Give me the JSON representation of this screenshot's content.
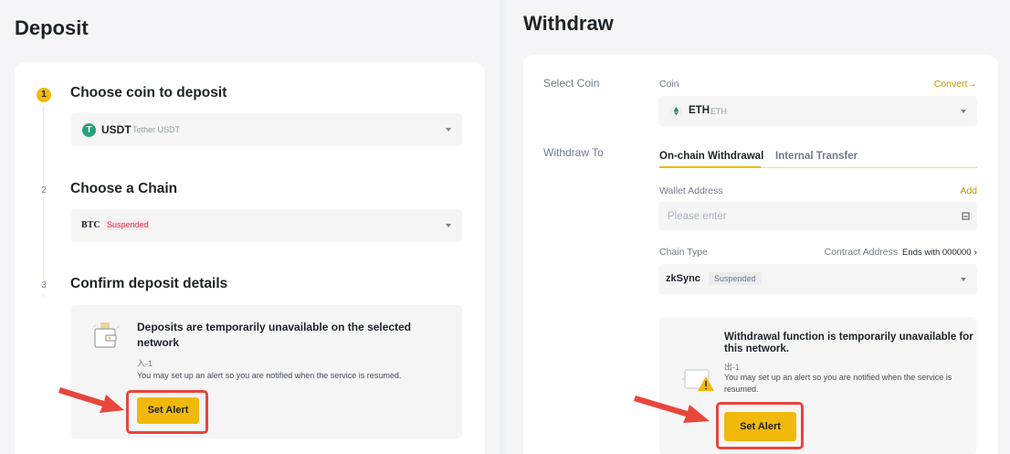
{
  "deposit": {
    "title": "Deposit",
    "steps": [
      {
        "number": "1",
        "title": "Choose coin to deposit"
      },
      {
        "number": "2",
        "title": "Choose a Chain"
      },
      {
        "number": "3",
        "title": "Confirm deposit details"
      }
    ],
    "coin_select": {
      "symbol": "USDT",
      "name": "Tether USDT",
      "icon": "tether-icon"
    },
    "chain_select": {
      "value": "BTC",
      "badge": "Suspended"
    },
    "notice": {
      "title_line1": "Deposits are temporarily unavailable on the selected",
      "title_line2": "network",
      "code": "入-1",
      "description": "You may set up an alert so you are notified when the service is resumed."
    },
    "alert_button": "Set Alert"
  },
  "withdraw": {
    "title": "Withdraw",
    "select_coin_label": "Select Coin",
    "withdraw_to_label": "Withdraw To",
    "coin_label": "Coin",
    "convert_link": "Convert→",
    "coin_select": {
      "symbol": "ETH",
      "sub": "ETH",
      "icon": "ethereum-icon"
    },
    "tabs": [
      "On-chain Withdrawal",
      "Internal Transfer"
    ],
    "active_tab": 0,
    "wallet_address_label": "Wallet Address",
    "add_link": "Add",
    "wallet_placeholder": "Please enter",
    "chain_type_label": "Chain Type",
    "contract_address_label": "Contract Address",
    "contract_address_value": "Ends with 000000",
    "chain_select": {
      "value": "zkSync",
      "badge": "Suspended"
    },
    "notice": {
      "title_line1": "Withdrawal function is temporarily unavailable for",
      "title_line2": "this network.",
      "code": "出-1",
      "description_line1": "You may set up an alert so you are notified when the service is",
      "description_line2": "resumed."
    },
    "alert_button": "Set Alert"
  },
  "colors": {
    "accent": "#f0b90b",
    "highlight": "#e8453c",
    "suspended": "#d9304e"
  }
}
